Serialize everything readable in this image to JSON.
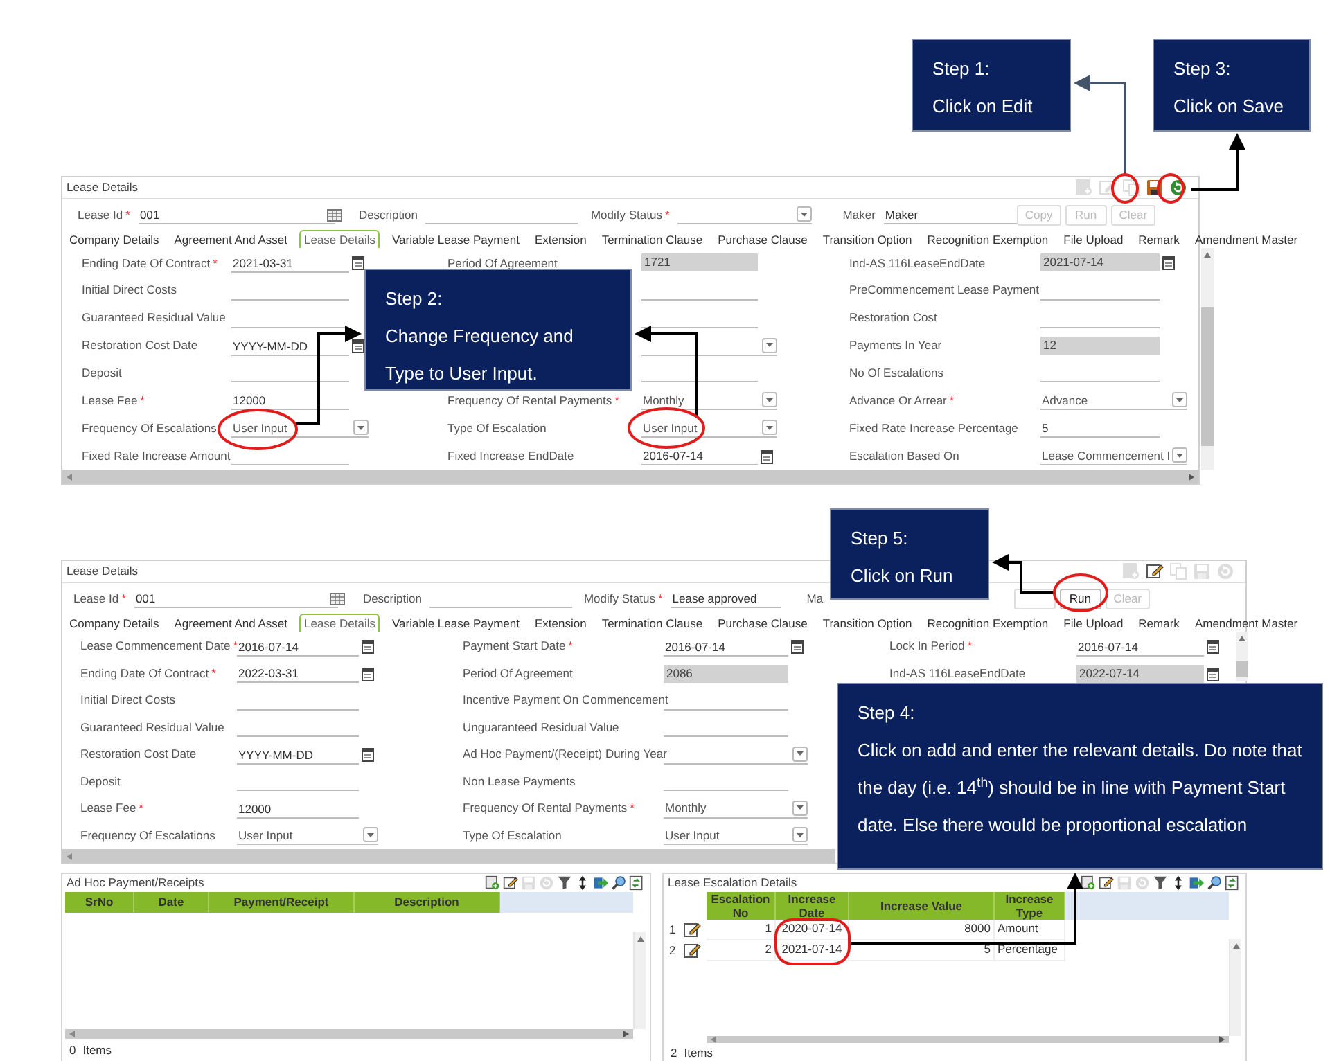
{
  "callouts": [
    {
      "title": "Step 1:",
      "text": "Click on Edit"
    },
    {
      "title": "Step 3:",
      "text": "Click on Save"
    },
    {
      "title": "Step 2:",
      "text": "Change Frequency and Type to User Input."
    },
    {
      "title": "Step 5:",
      "text": "Click on Run"
    },
    {
      "title": "Step 4:",
      "text": "Click on add and enter the relevant details. Do note that the day (i.e. 14$^{th}$) should be in line with Payment Start date. Else there would be proportional escalation"
    }
  ],
  "panels": [
    {
      "title": "Lease Details",
      "toolbar": [
        {
          "kind": "add",
          "disabled": true
        },
        {
          "kind": "edit",
          "disabled": true
        },
        {
          "kind": "copy",
          "disabled": true
        },
        {
          "kind": "save",
          "disabled": false
        },
        {
          "kind": "refresh",
          "disabled": false
        }
      ],
      "header": [
        {
          "label": "Lease Id",
          "mark": "*",
          "kind": "lookup",
          "value": "001"
        },
        {
          "label": "Description",
          "kind": "text"
        },
        {
          "label": "Modify Status",
          "mark": "*",
          "kind": "select"
        },
        {
          "label": "Maker",
          "kind": "text",
          "value": "Maker"
        }
      ],
      "buttons": [
        {
          "label": "Copy",
          "disabled": true
        },
        {
          "label": "Run",
          "disabled": true
        },
        {
          "label": "Clear",
          "disabled": true
        }
      ],
      "tabs": [
        {
          "label": "Company Details",
          "selected": false
        },
        {
          "label": "Agreement And Asset",
          "selected": false
        },
        {
          "label": "Lease Details",
          "selected": true
        },
        {
          "label": "Variable Lease Payment",
          "selected": false
        },
        {
          "label": "Extension",
          "selected": false
        },
        {
          "label": "Termination Clause",
          "selected": false
        },
        {
          "label": "Purchase Clause",
          "selected": false
        },
        {
          "label": "Transition Option",
          "selected": false
        },
        {
          "label": "Recognition Exemption",
          "selected": false
        },
        {
          "label": "File Upload",
          "selected": false
        },
        {
          "label": "Remark",
          "selected": false
        },
        {
          "label": "Amendment Master",
          "selected": false
        }
      ],
      "rows": [
        [
          {
            "label": "Ending Date Of Contract",
            "mark": "*",
            "kind": "date",
            "value": "2021-03-31"
          },
          {
            "label": "Period Of Agreement",
            "kind": "readonly",
            "value": "1721"
          },
          {
            "label": "Ind-AS 116LeaseEndDate",
            "kind": "readonly_date",
            "value": "2021-07-14"
          }
        ],
        [
          {
            "label": "Initial Direct Costs",
            "kind": "text"
          },
          {
            "kind": "text"
          },
          {
            "label": "PreCommencement Lease Payment",
            "kind": "text"
          }
        ],
        [
          {
            "label": "Guaranteed Residual Value",
            "kind": "text"
          },
          {
            "kind": "text"
          },
          {
            "label": "Restoration Cost",
            "kind": "text"
          }
        ],
        [
          {
            "label": "Restoration Cost Date",
            "kind": "date",
            "placeholder": "YYYY-MM-DD"
          },
          {
            "kind": "select"
          },
          {
            "label": "Payments In Year",
            "kind": "readonly",
            "value": "12"
          }
        ],
        [
          {
            "label": "Deposit",
            "kind": "text"
          },
          {
            "kind": "text"
          },
          {
            "label": "No Of Escalations",
            "kind": "text"
          }
        ],
        [
          {
            "label": "Lease Fee",
            "mark": "*",
            "kind": "text",
            "value": "12000"
          },
          {
            "label": "Frequency Of Rental Payments",
            "mark": "*",
            "kind": "select",
            "value": "Monthly"
          },
          {
            "label": "Advance Or Arrear",
            "mark": "*",
            "kind": "select",
            "value": "Advance"
          }
        ],
        [
          {
            "label": "Frequency Of Escalations",
            "kind": "select",
            "value": "User Input"
          },
          {
            "label": "Type Of Escalation",
            "kind": "select",
            "value": "User Input"
          },
          {
            "label": "Fixed Rate Increase Percentage",
            "kind": "text",
            "value": "5"
          }
        ],
        [
          {
            "label": "Fixed Rate Increase Amount",
            "kind": "text"
          },
          {
            "label": "Fixed Increase EndDate",
            "kind": "date",
            "value": "2016-07-14"
          },
          {
            "label": "Escalation Based On",
            "kind": "select",
            "value": "Lease Commencement I"
          }
        ]
      ]
    },
    {
      "title": "Lease Details",
      "toolbar": [
        {
          "kind": "add",
          "disabled": true
        },
        {
          "kind": "edit",
          "disabled": false
        },
        {
          "kind": "copy",
          "disabled": true
        },
        {
          "kind": "save",
          "disabled": true
        },
        {
          "kind": "refresh",
          "disabled": true
        }
      ],
      "header": [
        {
          "label": "Lease Id",
          "mark": "*",
          "kind": "lookup",
          "value": "001"
        },
        {
          "label": "Description",
          "kind": "text"
        },
        {
          "label": "Modify Status",
          "mark": "*",
          "kind": "text",
          "value": "Lease approved"
        },
        {
          "label": "Ma"
        }
      ],
      "buttons": [
        {
          "disabled": true
        },
        {
          "label": "Run",
          "disabled": false
        },
        {
          "label": "Clear",
          "disabled": true
        }
      ],
      "tabs": [
        {
          "label": "Company Details",
          "selected": false
        },
        {
          "label": "Agreement And Asset",
          "selected": false
        },
        {
          "label": "Lease Details",
          "selected": true
        },
        {
          "label": "Variable Lease Payment",
          "selected": false
        },
        {
          "label": "Extension",
          "selected": false
        },
        {
          "label": "Termination Clause",
          "selected": false
        },
        {
          "label": "Purchase Clause",
          "selected": false
        },
        {
          "label": "Transition Option",
          "selected": false
        },
        {
          "label": "Recognition Exemption",
          "selected": false
        },
        {
          "label": "File Upload",
          "selected": false
        },
        {
          "label": "Remark",
          "selected": false
        },
        {
          "label": "Amendment Master",
          "selected": false
        }
      ],
      "rows": [
        [
          {
            "label": "Lease Commencement Date",
            "mark": "*",
            "kind": "date",
            "value": "2016-07-14"
          },
          {
            "label": "Payment Start Date",
            "mark": "*",
            "kind": "date",
            "value": "2016-07-14"
          },
          {
            "label": "Lock In Period",
            "mark": "*",
            "kind": "date",
            "value": "2016-07-14"
          }
        ],
        [
          {
            "label": "Ending Date Of Contract",
            "mark": "*",
            "kind": "date",
            "value": "2022-03-31"
          },
          {
            "label": "Period Of Agreement",
            "kind": "readonly",
            "value": "2086"
          },
          {
            "label": "Ind-AS 116LeaseEndDate",
            "kind": "readonly_date",
            "value": "2022-07-14"
          }
        ],
        [
          {
            "label": "Initial Direct Costs",
            "kind": "text"
          },
          {
            "label": "Incentive Payment On Commencement",
            "kind": "text"
          },
          null
        ],
        [
          {
            "label": "Guaranteed Residual Value",
            "kind": "text"
          },
          {
            "label": "Unguaranteed Residual Value",
            "kind": "text"
          },
          null
        ],
        [
          {
            "label": "Restoration Cost Date",
            "kind": "date",
            "placeholder": "YYYY-MM-DD"
          },
          {
            "label": "Ad Hoc Payment/(Receipt) During Year",
            "kind": "select"
          },
          null
        ],
        [
          {
            "label": "Deposit",
            "kind": "text"
          },
          {
            "label": "Non Lease Payments",
            "kind": "text"
          },
          null
        ],
        [
          {
            "label": "Lease Fee",
            "mark": "*",
            "kind": "text",
            "value": "12000"
          },
          {
            "label": "Frequency Of Rental Payments",
            "mark": "*",
            "kind": "select",
            "value": "Monthly"
          },
          null
        ],
        [
          {
            "label": "Frequency Of Escalations",
            "kind": "select",
            "value": "User Input"
          },
          {
            "label": "Type Of Escalation",
            "kind": "select",
            "value": "User Input"
          },
          null
        ]
      ]
    }
  ],
  "grids": [
    {
      "title": "Ad Hoc Payment/Receipts",
      "toolbar": [
        {
          "kind": "add",
          "disabled": false
        },
        {
          "kind": "edit",
          "disabled": false
        },
        {
          "kind": "save",
          "disabled": true
        },
        {
          "kind": "refresh",
          "disabled": true
        },
        {
          "kind": "filter",
          "disabled": false
        },
        {
          "kind": "sort",
          "disabled": false
        },
        {
          "kind": "export",
          "disabled": false
        },
        {
          "kind": "search",
          "disabled": false
        },
        {
          "kind": "reload",
          "disabled": false
        }
      ],
      "columns": [
        "SrNo",
        "Date",
        "Payment/Receipt",
        "Description"
      ],
      "count": "0",
      "count_label": "Items"
    },
    {
      "title": "Lease Escalation Details",
      "toolbar": [
        {
          "kind": "add",
          "disabled": false
        },
        {
          "kind": "edit",
          "disabled": false
        },
        {
          "kind": "save",
          "disabled": true
        },
        {
          "kind": "refresh",
          "disabled": true
        },
        {
          "kind": "filter",
          "disabled": false
        },
        {
          "kind": "sort",
          "disabled": false
        },
        {
          "kind": "export",
          "disabled": false
        },
        {
          "kind": "search",
          "disabled": false
        },
        {
          "kind": "reload",
          "disabled": false
        }
      ],
      "columns": [
        "Escalation No",
        "Increase Date",
        "Increase Value",
        "Increase Type"
      ],
      "rows": [
        {
          "number": "1",
          "cells": [
            "1",
            "2020-07-14",
            "8000",
            "Amount"
          ]
        },
        {
          "number": "2",
          "cells": [
            "2",
            "2021-07-14",
            "5",
            "Percentage"
          ]
        }
      ],
      "count": "2",
      "count_label": "Items"
    }
  ]
}
